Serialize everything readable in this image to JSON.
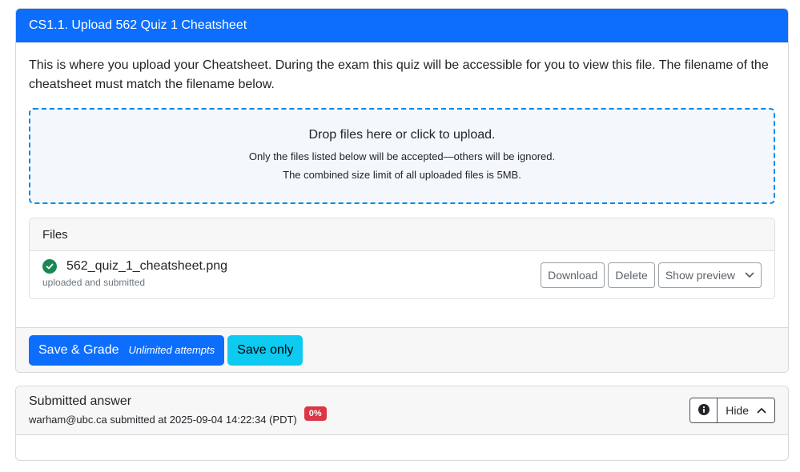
{
  "question": {
    "title": "CS1.1. Upload 562 Quiz 1 Cheatsheet",
    "instructions": "This is where you upload your Cheatsheet. During the exam this quiz will be accessible for you to view this file. The filename of the cheatsheet must match the filename below."
  },
  "dropzone": {
    "main": "Drop files here or click to upload.",
    "note1": "Only the files listed below will be accepted—others will be ignored.",
    "note2": "The combined size limit of all uploaded files is 5MB."
  },
  "files": {
    "header": "Files",
    "items": [
      {
        "name": "562_quiz_1_cheatsheet.png",
        "status": "uploaded and submitted",
        "status_icon": "check-circle-icon",
        "actions": {
          "download": "Download",
          "delete": "Delete",
          "preview": "Show preview"
        }
      }
    ]
  },
  "footer": {
    "save_grade": "Save & Grade",
    "attempts": "Unlimited attempts",
    "save_only": "Save only"
  },
  "submission": {
    "title": "Submitted answer",
    "meta": "warham@ubc.ca submitted at 2025-09-04 14:22:34 (PDT)",
    "score": "0%",
    "hide_label": "Hide",
    "info_icon": "info-circle-icon"
  },
  "colors": {
    "primary": "#0d6efd",
    "info": "#0dcaf0",
    "success": "#198754",
    "danger": "#dc3545"
  }
}
